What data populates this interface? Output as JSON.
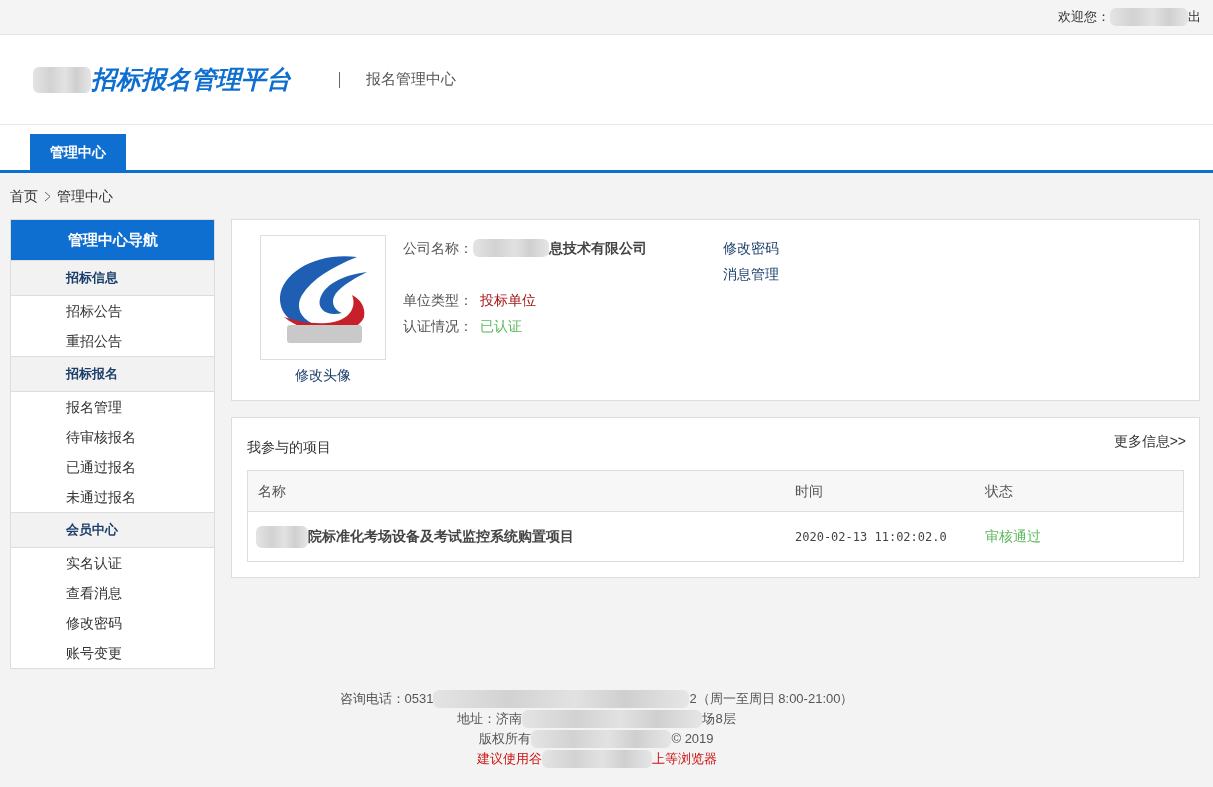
{
  "top_bar": {
    "welcome": "欢迎您：",
    "logout": "出"
  },
  "header": {
    "title": "招标报名管理平台",
    "subtitle": "报名管理中心"
  },
  "nav_tabs": [
    {
      "label": "管理中心",
      "selected": true
    }
  ],
  "breadcrumb": [
    "首页",
    "管理中心"
  ],
  "sidebar": {
    "title": "管理中心导航",
    "sections": [
      {
        "title": "招标信息",
        "items": [
          "招标公告",
          "重招公告"
        ]
      },
      {
        "title": "招标报名",
        "items": [
          "报名管理",
          "待审核报名",
          "已通过报名",
          "未通过报名"
        ]
      },
      {
        "title": "会员中心",
        "items": [
          "实名认证",
          "查看消息",
          "修改密码",
          "账号变更"
        ]
      }
    ]
  },
  "profile": {
    "change_avatar": "修改头像",
    "company_label": "公司名称：",
    "company_name": "息技术有限公司",
    "type_label": "单位类型：",
    "type_value": "投标单位",
    "cert_label": "认证情况：",
    "cert_value": "已认证",
    "links": [
      "修改密码",
      "消息管理"
    ]
  },
  "projects": {
    "title": "我参与的项目",
    "more": "更多信息>>",
    "columns": [
      "名称",
      "时间",
      "状态"
    ],
    "rows": [
      {
        "name": "院标准化考场设备及考试监控系统购置项目",
        "time": "2020-02-13 11:02:02.0",
        "status": "审核通过"
      }
    ]
  },
  "footer": {
    "phone_start": "咨询电话：0531",
    "phone_end": "2（周一至周日 8:00-21:00）",
    "address_start": "地址：济南",
    "address_end": "场8层",
    "copyright_start": "版权所有",
    "copyright_end": "© 2019",
    "browser_start": "建议使用谷",
    "browser_end": "上等浏览器"
  }
}
